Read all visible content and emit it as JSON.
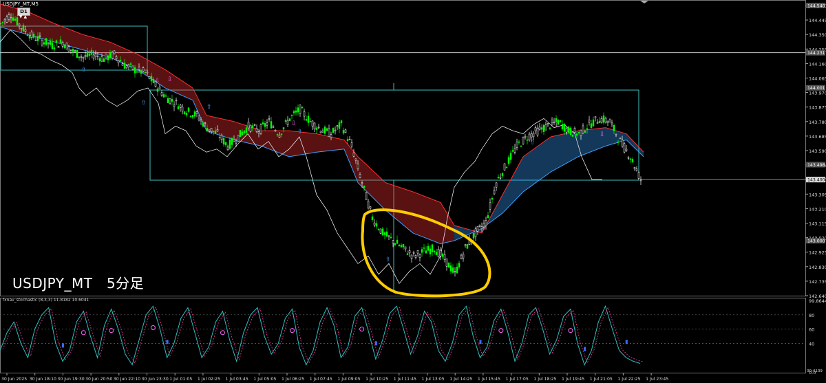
{
  "symbol_bar": {
    "symbol": "USDJPY_MT,M5",
    "timeframe": "D1",
    "arrows": "▼ ▲"
  },
  "overlay_label": "USDJPY_MT　5分足",
  "oscillator_label": "fxnav_stochastic (8,3,3) 11.8182 10.6041",
  "colors": {
    "background": "#000000",
    "bull_candle": "#00ff00",
    "bear_candle": "#ffffff",
    "cloud_bear": "#ff3030",
    "cloud_bull": "#3aa0ff",
    "box": "#3fbfbf",
    "highlight": "#ffcc00",
    "current_price_line": "#ff4d6d"
  },
  "price_axis": {
    "ticks": [
      "144.540",
      "144.445",
      "144.350",
      "144.255",
      "144.160",
      "144.065",
      "143.970",
      "143.875",
      "143.780",
      "143.685",
      "143.590",
      "143.495",
      "143.400",
      "143.305",
      "143.210",
      "143.115",
      "143.020",
      "142.925",
      "142.830",
      "142.735",
      "142.640"
    ],
    "marked_levels": [
      "144.540",
      "144.231",
      "144.001",
      "143.498",
      "143.400",
      "143.000"
    ],
    "current_price": "143.400"
  },
  "osc_axis": {
    "ticks": [
      "99.8644",
      "80",
      "60",
      "40",
      "0.0"
    ],
    "bottom_extra": "00:4139"
  },
  "time_axis": {
    "ticks": [
      "30 Jun 2025",
      "30 Jun 18:10",
      "30 Jun 19:30",
      "30 Jun 20:50",
      "30 Jun 22:10",
      "30 Jun 23:30",
      "1 Jul 01:05",
      "1 Jul 02:25",
      "1 Jul 03:45",
      "1 Jul 05:05",
      "1 Jul 06:25",
      "1 Jul 07:45",
      "1 Jul 09:05",
      "1 Jul 10:25",
      "1 Jul 11:45",
      "1 Jul 13:05",
      "1 Jul 14:25",
      "1 Jul 15:45",
      "1 Jul 17:05",
      "1 Jul 18:25",
      "1 Jul 19:45",
      "1 Jul 21:05",
      "1 Jul 22:25",
      "1 Jul 23:45"
    ]
  },
  "price_series": [
    [
      0,
      144.42
    ],
    [
      15,
      144.48
    ],
    [
      30,
      144.4
    ],
    [
      45,
      144.34
    ],
    [
      60,
      144.31
    ],
    [
      75,
      144.28
    ],
    [
      90,
      144.3
    ],
    [
      105,
      144.24
    ],
    [
      120,
      144.2
    ],
    [
      135,
      144.22
    ],
    [
      150,
      144.19
    ],
    [
      165,
      144.22
    ],
    [
      180,
      144.15
    ],
    [
      195,
      144.12
    ],
    [
      210,
      144.1
    ],
    [
      225,
      144.02
    ],
    [
      240,
      143.94
    ],
    [
      255,
      143.9
    ],
    [
      270,
      143.85
    ],
    [
      285,
      143.82
    ],
    [
      300,
      143.74
    ],
    [
      315,
      143.7
    ],
    [
      330,
      143.62
    ],
    [
      345,
      143.68
    ],
    [
      360,
      143.75
    ],
    [
      375,
      143.72
    ],
    [
      390,
      143.78
    ],
    [
      405,
      143.7
    ],
    [
      420,
      143.8
    ],
    [
      435,
      143.86
    ],
    [
      450,
      143.78
    ],
    [
      465,
      143.73
    ],
    [
      480,
      143.7
    ],
    [
      495,
      143.76
    ],
    [
      510,
      143.62
    ],
    [
      525,
      143.38
    ],
    [
      540,
      143.15
    ],
    [
      555,
      143.05
    ],
    [
      570,
      143.0
    ],
    [
      585,
      142.95
    ],
    [
      600,
      142.9
    ],
    [
      615,
      142.93
    ],
    [
      630,
      142.95
    ],
    [
      645,
      142.88
    ],
    [
      660,
      142.78
    ],
    [
      675,
      142.95
    ],
    [
      690,
      143.05
    ],
    [
      705,
      143.12
    ],
    [
      720,
      143.38
    ],
    [
      735,
      143.5
    ],
    [
      750,
      143.62
    ],
    [
      765,
      143.68
    ],
    [
      780,
      143.72
    ],
    [
      795,
      143.75
    ],
    [
      810,
      143.78
    ],
    [
      825,
      143.72
    ],
    [
      840,
      143.7
    ],
    [
      855,
      143.76
    ],
    [
      870,
      143.8
    ],
    [
      885,
      143.78
    ],
    [
      900,
      143.65
    ],
    [
      915,
      143.55
    ],
    [
      930,
      143.4
    ]
  ],
  "white_line": [
    [
      0,
      144.3
    ],
    [
      15,
      144.38
    ],
    [
      30,
      144.32
    ],
    [
      45,
      144.25
    ],
    [
      60,
      144.22
    ],
    [
      75,
      144.18
    ],
    [
      90,
      144.15
    ],
    [
      105,
      144.1
    ],
    [
      115,
      144.0
    ],
    [
      125,
      143.95
    ],
    [
      140,
      144.0
    ],
    [
      155,
      143.92
    ],
    [
      170,
      143.88
    ],
    [
      185,
      143.92
    ],
    [
      200,
      143.98
    ],
    [
      215,
      144.0
    ],
    [
      230,
      143.9
    ],
    [
      240,
      143.7
    ],
    [
      255,
      143.75
    ],
    [
      270,
      143.72
    ],
    [
      285,
      143.62
    ],
    [
      300,
      143.58
    ],
    [
      315,
      143.6
    ],
    [
      330,
      143.55
    ],
    [
      345,
      143.63
    ],
    [
      360,
      143.7
    ],
    [
      375,
      143.6
    ],
    [
      390,
      143.65
    ],
    [
      405,
      143.55
    ],
    [
      420,
      143.6
    ],
    [
      435,
      143.68
    ],
    [
      445,
      143.55
    ],
    [
      460,
      143.3
    ],
    [
      475,
      143.2
    ],
    [
      490,
      143.05
    ],
    [
      505,
      142.95
    ],
    [
      520,
      142.85
    ],
    [
      535,
      142.9
    ],
    [
      550,
      142.78
    ],
    [
      565,
      142.85
    ],
    [
      580,
      142.72
    ],
    [
      595,
      142.8
    ],
    [
      610,
      142.85
    ],
    [
      625,
      142.78
    ],
    [
      640,
      142.9
    ],
    [
      650,
      143.15
    ],
    [
      660,
      143.35
    ],
    [
      675,
      143.45
    ],
    [
      690,
      143.52
    ],
    [
      700,
      143.6
    ],
    [
      715,
      143.7
    ],
    [
      730,
      143.75
    ],
    [
      745,
      143.72
    ],
    [
      760,
      143.7
    ],
    [
      775,
      143.76
    ],
    [
      790,
      143.8
    ],
    [
      805,
      143.74
    ],
    [
      820,
      143.76
    ],
    [
      835,
      143.7
    ],
    [
      845,
      143.55
    ],
    [
      860,
      143.4
    ],
    [
      875,
      143.4
    ]
  ],
  "cloud_upper": [
    [
      0,
      144.55
    ],
    [
      40,
      144.5
    ],
    [
      80,
      144.42
    ],
    [
      120,
      144.35
    ],
    [
      160,
      144.3
    ],
    [
      200,
      144.22
    ],
    [
      240,
      144.12
    ],
    [
      280,
      144.0
    ],
    [
      300,
      143.82
    ],
    [
      340,
      143.78
    ],
    [
      380,
      143.72
    ],
    [
      420,
      143.72
    ],
    [
      460,
      143.7
    ],
    [
      500,
      143.66
    ],
    [
      520,
      143.55
    ],
    [
      560,
      143.38
    ],
    [
      600,
      143.32
    ],
    [
      640,
      143.25
    ],
    [
      660,
      143.1
    ],
    [
      700,
      143.05
    ],
    [
      730,
      143.3
    ],
    [
      760,
      143.55
    ],
    [
      800,
      143.68
    ],
    [
      840,
      143.72
    ],
    [
      880,
      143.74
    ],
    [
      910,
      143.7
    ],
    [
      935,
      143.58
    ]
  ],
  "cloud_lower": [
    [
      0,
      144.4
    ],
    [
      40,
      144.35
    ],
    [
      80,
      144.3
    ],
    [
      120,
      144.25
    ],
    [
      160,
      144.2
    ],
    [
      200,
      144.12
    ],
    [
      240,
      144.0
    ],
    [
      280,
      143.92
    ],
    [
      300,
      143.72
    ],
    [
      340,
      143.66
    ],
    [
      380,
      143.62
    ],
    [
      420,
      143.55
    ],
    [
      460,
      143.58
    ],
    [
      500,
      143.6
    ],
    [
      520,
      143.38
    ],
    [
      560,
      143.2
    ],
    [
      600,
      143.05
    ],
    [
      640,
      142.98
    ],
    [
      660,
      143.0
    ],
    [
      700,
      143.08
    ],
    [
      730,
      143.18
    ],
    [
      760,
      143.32
    ],
    [
      800,
      143.45
    ],
    [
      840,
      143.55
    ],
    [
      880,
      143.62
    ],
    [
      910,
      143.66
    ],
    [
      935,
      143.55
    ]
  ],
  "stoch_values": [
    30,
    55,
    70,
    40,
    20,
    60,
    80,
    90,
    40,
    15,
    30,
    70,
    85,
    50,
    20,
    65,
    88,
    60,
    25,
    10,
    45,
    80,
    92,
    60,
    20,
    40,
    75,
    90,
    55,
    20,
    35,
    70,
    85,
    45,
    15,
    55,
    80,
    90,
    50,
    25,
    40,
    75,
    88,
    35,
    10,
    30,
    70,
    90,
    65,
    20,
    35,
    78,
    90,
    55,
    18,
    45,
    82,
    92,
    60,
    25,
    50,
    85,
    70,
    30,
    15,
    40,
    80,
    92,
    50,
    20,
    35,
    72,
    88,
    55,
    15,
    40,
    80,
    90,
    60,
    25,
    45,
    78,
    88,
    40,
    10,
    30,
    70,
    92,
    60,
    30,
    20,
    15,
    12
  ]
}
